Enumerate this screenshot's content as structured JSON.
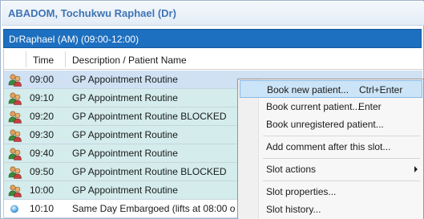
{
  "doctor": {
    "name": "ABADOM, Tochukwu Raphael (Dr)"
  },
  "session": {
    "title": "DrRaphael (AM) (09:00-12:00)"
  },
  "columns": {
    "time": "Time",
    "description": "Description / Patient Name"
  },
  "rows": [
    {
      "icon": "patients-icon",
      "time": "09:00",
      "description": "GP Appointment Routine",
      "selected": true
    },
    {
      "icon": "patients-icon",
      "time": "09:10",
      "description": "GP Appointment Routine"
    },
    {
      "icon": "patients-icon",
      "time": "09:20",
      "description": "GP Appointment Routine BLOCKED"
    },
    {
      "icon": "patients-icon",
      "time": "09:30",
      "description": "GP Appointment Routine"
    },
    {
      "icon": "patients-icon",
      "time": "09:40",
      "description": "GP Appointment Routine"
    },
    {
      "icon": "patients-icon",
      "time": "09:50",
      "description": "GP Appointment Routine BLOCKED"
    },
    {
      "icon": "patients-icon",
      "time": "10:00",
      "description": "GP Appointment Routine"
    },
    {
      "icon": "blue-dot-icon",
      "time": "10:10",
      "description": "Same Day  Embargoed (lifts at 08:00 o"
    }
  ],
  "context_menu": {
    "items": [
      {
        "label": "Book new patient...",
        "shortcut": "Ctrl+Enter",
        "highlighted": true
      },
      {
        "label": "Book current patient...",
        "shortcut": "Enter"
      },
      {
        "label": "Book unregistered patient..."
      },
      {
        "label": "Add comment after this slot..."
      },
      {
        "label": "Slot actions",
        "submenu": true
      },
      {
        "label": "Slot properties..."
      },
      {
        "label": "Slot history..."
      }
    ]
  },
  "colors": {
    "session_bar": "#1d6fbf",
    "doctor_name": "#3f74b4",
    "row_background": "#d4ecec",
    "selected_row": "#cfe1f3",
    "menu_highlight": "#cce4f7"
  }
}
